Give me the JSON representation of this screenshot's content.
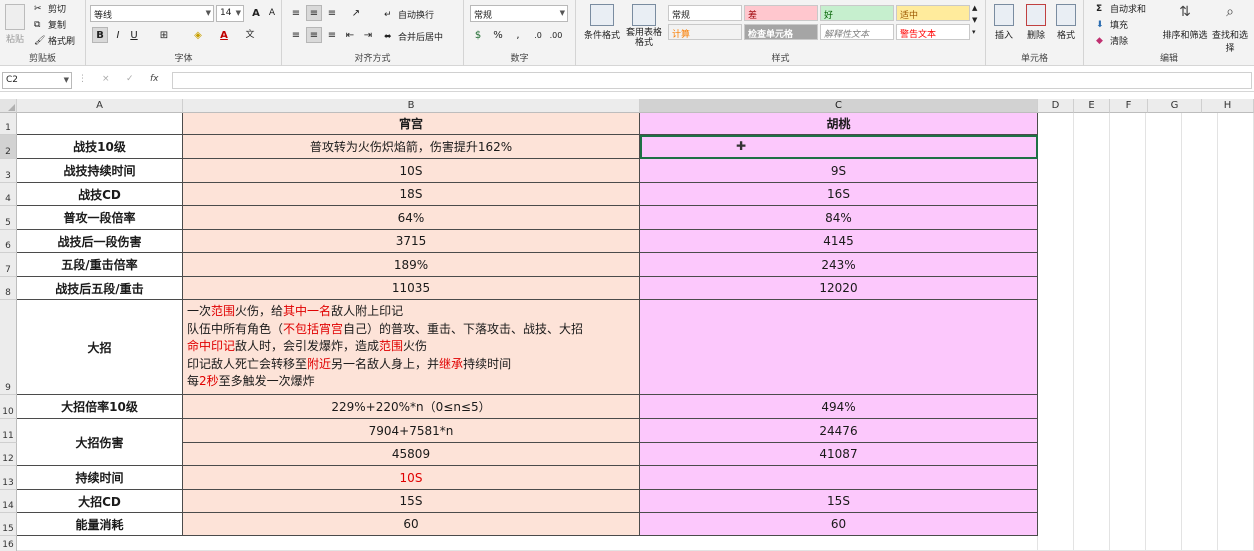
{
  "ribbon": {
    "clipboard": {
      "paste": "粘贴",
      "cut": "剪切",
      "copy": "复制",
      "format_painter": "格式刷",
      "label": "剪贴板"
    },
    "font": {
      "name": "等线",
      "size": "14",
      "grow": "A",
      "shrink": "A",
      "bold": "B",
      "italic": "I",
      "underline": "U",
      "wen": "文",
      "label": "字体"
    },
    "alignment": {
      "wrap": "自动换行",
      "merge": "合并后居中",
      "label": "对齐方式"
    },
    "number": {
      "format": "常规",
      "label": "数字"
    },
    "styles": {
      "conditional": "条件格式",
      "table": "套用表格格式",
      "cells": [
        {
          "text": "常规",
          "bg": "#ffffff",
          "color": "#222222"
        },
        {
          "text": "差",
          "bg": "#ffc7ce",
          "color": "#9c0006"
        },
        {
          "text": "好",
          "bg": "#c6efce",
          "color": "#006100"
        },
        {
          "text": "适中",
          "bg": "#ffeb9c",
          "color": "#9c5700"
        },
        {
          "text": "计算",
          "bg": "#f2f2f2",
          "color": "#fa7d00"
        },
        {
          "text": "检查单元格",
          "bg": "#a5a5a5",
          "color": "#ffffff"
        },
        {
          "text": "解释性文本",
          "bg": "#ffffff",
          "color": "#7f7f7f"
        },
        {
          "text": "警告文本",
          "bg": "#ffffff",
          "color": "#ff0000"
        }
      ],
      "label": "样式"
    },
    "cells": {
      "insert": "插入",
      "delete": "删除",
      "format": "格式",
      "label": "单元格"
    },
    "editing": {
      "autosum": "自动求和",
      "fill": "填充",
      "clear": "清除",
      "sort": "排序和筛选",
      "find": "查找和选择",
      "label": "编辑"
    }
  },
  "formula_bar": {
    "name_box": "C2",
    "cancel": "×",
    "enter": "✓",
    "fx": "fx",
    "value": ""
  },
  "columns": [
    "A",
    "B",
    "C",
    "D",
    "E",
    "F",
    "G",
    "H"
  ],
  "rows": [
    "1",
    "2",
    "3",
    "4",
    "5",
    "6",
    "7",
    "8",
    "9",
    "10",
    "11",
    "12",
    "13",
    "14",
    "15",
    "16"
  ],
  "table": {
    "header_b": "宵宫",
    "header_c": "胡桃",
    "r2": {
      "a": "战技10级",
      "b": "普攻转为火伤炽焰箭，伤害提升162%",
      "c": ""
    },
    "r3": {
      "a": "战技持续时间",
      "b": "10S",
      "c": "9S"
    },
    "r4": {
      "a": "战技CD",
      "b": "18S",
      "c": "16S"
    },
    "r5": {
      "a": "普攻一段倍率",
      "b": "64%",
      "c": "84%"
    },
    "r6": {
      "a": "战技后一段伤害",
      "b": "3715",
      "c": "4145"
    },
    "r7": {
      "a": "五段/重击倍率",
      "b": "189%",
      "c": "243%"
    },
    "r8": {
      "a": "战技后五段/重击",
      "b": "11035",
      "c": "12020"
    },
    "r9": {
      "a": "大招",
      "lines": [
        [
          "一次",
          "范围",
          "火伤，给",
          "其中一名",
          "敌人附上印记"
        ],
        [
          "队伍中所有角色（",
          "不包括宵宫",
          "自己）的普攻、重击、下落攻击、战技、大招"
        ],
        [
          "",
          "命中印记",
          "敌人时，会引发爆炸，造成",
          "范围",
          "火伤"
        ],
        [
          "印记敌人死亡会转移至",
          "附近",
          "另一名敌人身上，并",
          "继承",
          "持续时间"
        ],
        [
          "每",
          "2秒",
          "至多触发一次爆炸"
        ]
      ],
      "c": ""
    },
    "r10": {
      "a": "大招倍率10级",
      "b": "229%+220%*n（0≤n≤5）",
      "c": "494%"
    },
    "r11": {
      "a": "大招伤害",
      "b": "7904+7581*n",
      "c": "24476"
    },
    "r12": {
      "b": "45809",
      "c": "41087"
    },
    "r13": {
      "a": "持续时间",
      "b": "10S",
      "c": ""
    },
    "r14": {
      "a": "大招CD",
      "b": "15S",
      "c": "15S"
    },
    "r15": {
      "a": "能量消耗",
      "b": "60",
      "c": "60"
    }
  }
}
